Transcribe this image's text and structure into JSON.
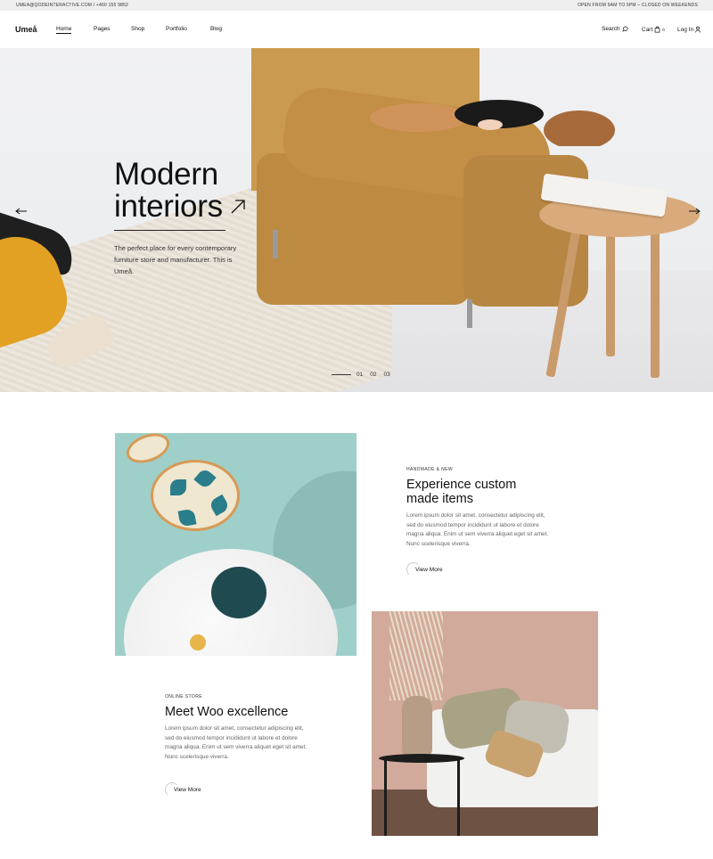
{
  "topbar": {
    "contact": "UMEA@QODEINTERACTIVE.COM / +460 155 9852",
    "hours": "OPEN FROM 9AM TO 5PM – CLOSED ON WEEKENDS"
  },
  "header": {
    "logo": "Umeå",
    "nav": [
      "Home",
      "Pages",
      "Shop",
      "Portfolio",
      "Blog"
    ],
    "search_label": "Search",
    "cart_label": "Cart",
    "cart_count": "0",
    "login_label": "Log In"
  },
  "hero": {
    "title_line1": "Modern",
    "title_line2": "interiors",
    "description": "The perfect place for every contemporary furniture store and manufacturer. This is Umeå.",
    "slides": [
      "01",
      "02",
      "03"
    ]
  },
  "section1": {
    "eyebrow": "HANDMADE & NEW",
    "title_line1": "Experience custom",
    "title_line2": "made items",
    "body": "Lorem ipsum dolor sit amet, consectetur adipiscing elit, sed do eiusmod tempor incididunt ut labore et dolore magna aliqua. Enim ut sem viverra aliquet eget sit amet. Nunc scelerisque viverra.",
    "cta": "View More"
  },
  "section2": {
    "eyebrow": "ONLINE STORE",
    "title": "Meet Woo excellence",
    "body": "Lorem ipsum dolor sit amet, consectetur adipiscing elit, sed do eiusmod tempor incididunt ut labore et dolore magna aliqua. Enim ut sem viverra aliquet eget sit amet. Nunc scelerisque viverra.",
    "cta": "View More"
  },
  "icons": {
    "search": "search-icon",
    "cart": "cart-icon",
    "user": "user-icon",
    "hero_arrow": "arrow-up-right-icon",
    "prev": "arrow-left-icon",
    "next": "arrow-right-icon"
  }
}
